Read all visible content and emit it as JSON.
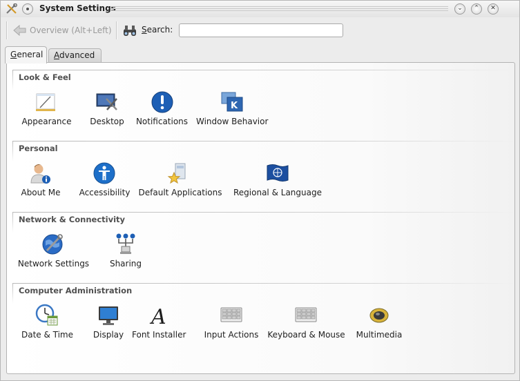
{
  "window": {
    "title": "System Settings"
  },
  "toolbar": {
    "overview_label": "Overview (Alt+Left)",
    "search_label_underlined": "S",
    "search_label_rest": "earch:",
    "search_value": "",
    "search_placeholder": ""
  },
  "tabs": [
    {
      "label_underlined": "G",
      "label_rest": "eneral",
      "active": true
    },
    {
      "label_underlined": "A",
      "label_rest": "dvanced",
      "active": false
    }
  ],
  "groups": [
    {
      "title": "Look & Feel",
      "items": [
        {
          "label": "Appearance",
          "icon": "appearance-icon"
        },
        {
          "label": "Desktop",
          "icon": "desktop-icon"
        },
        {
          "label": "Notifications",
          "icon": "notifications-icon"
        },
        {
          "label": "Window Behavior",
          "icon": "window-behavior-icon"
        }
      ]
    },
    {
      "title": "Personal",
      "items": [
        {
          "label": "About Me",
          "icon": "about-me-icon"
        },
        {
          "label": "Accessibility",
          "icon": "accessibility-icon"
        },
        {
          "label": "Default Applications",
          "icon": "default-applications-icon"
        },
        {
          "label": "Regional & Language",
          "icon": "regional-language-icon"
        }
      ]
    },
    {
      "title": "Network & Connectivity",
      "items": [
        {
          "label": "Network Settings",
          "icon": "network-settings-icon"
        },
        {
          "label": "Sharing",
          "icon": "sharing-icon"
        }
      ]
    },
    {
      "title": "Computer Administration",
      "items": [
        {
          "label": "Date & Time",
          "icon": "date-time-icon"
        },
        {
          "label": "Display",
          "icon": "display-icon"
        },
        {
          "label": "Font Installer",
          "icon": "font-installer-icon"
        },
        {
          "label": "Input Actions",
          "icon": "input-actions-icon"
        },
        {
          "label": "Keyboard & Mouse",
          "icon": "keyboard-mouse-icon"
        },
        {
          "label": "Multimedia",
          "icon": "multimedia-icon"
        }
      ]
    }
  ],
  "colors": {
    "accent_blue": "#1d5fb5",
    "panel_border": "#b3b3b3"
  }
}
